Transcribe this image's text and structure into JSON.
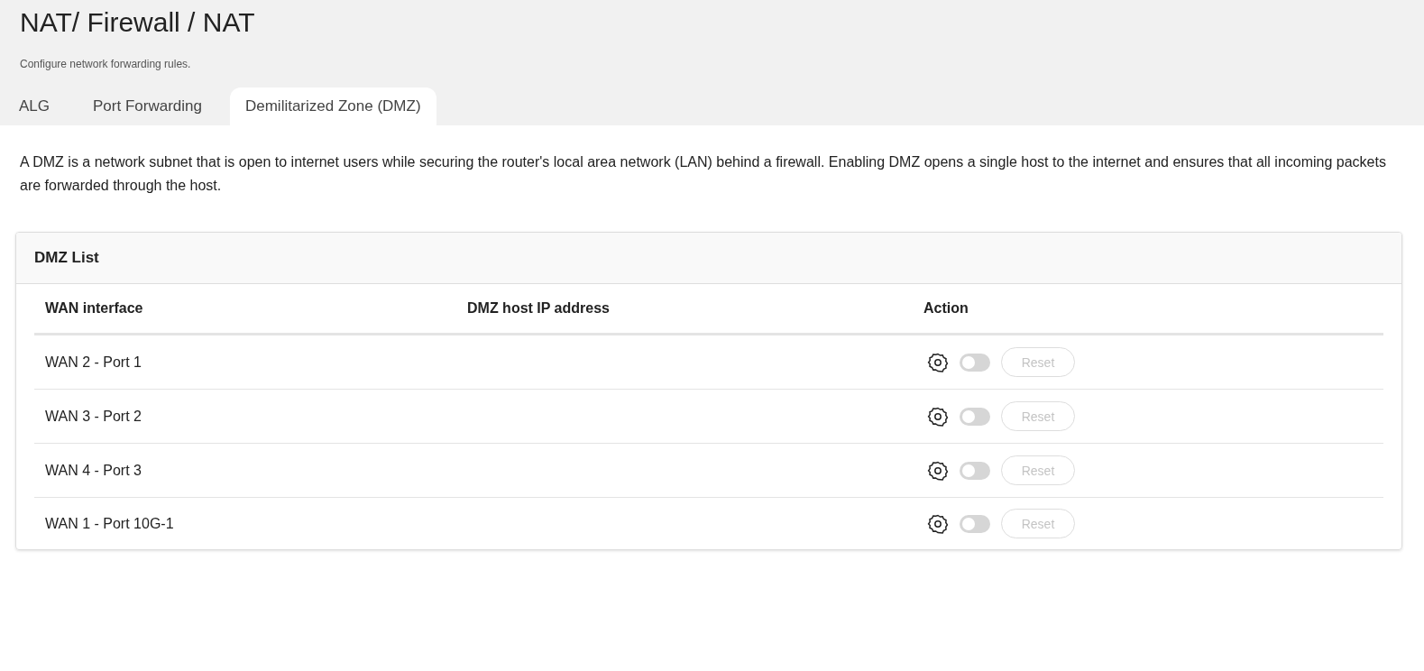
{
  "page": {
    "title": "NAT/ Firewall / NAT",
    "subtitle": "Configure network forwarding rules."
  },
  "tabs": [
    {
      "label": "ALG",
      "selected": false
    },
    {
      "label": "Port Forwarding",
      "selected": false
    },
    {
      "label": "Demilitarized Zone (DMZ)",
      "selected": true
    }
  ],
  "description": "A DMZ is a network subnet that is open to internet users while securing the router's local area network (LAN) behind a firewall. Enabling DMZ opens a single host to the internet and ensures that all incoming packets are forwarded through the host.",
  "card": {
    "title": "DMZ List",
    "columns": [
      "WAN interface",
      "DMZ host IP address",
      "Action"
    ],
    "rows": [
      {
        "wan": "WAN 2 - Port 1",
        "on": false,
        "reset": {
          "label": "Reset",
          "disabled": true
        }
      },
      {
        "wan": "WAN 3 - Port 2",
        "on": false,
        "reset": {
          "label": "Reset",
          "disabled": true
        }
      },
      {
        "wan": "WAN 4 - Port 3",
        "on": false,
        "reset": {
          "label": "Reset",
          "disabled": true
        }
      },
      {
        "wan": "WAN 1 - Port 10G-1",
        "on": false,
        "reset": {
          "label": "Reset",
          "disabled": true
        }
      }
    ]
  }
}
